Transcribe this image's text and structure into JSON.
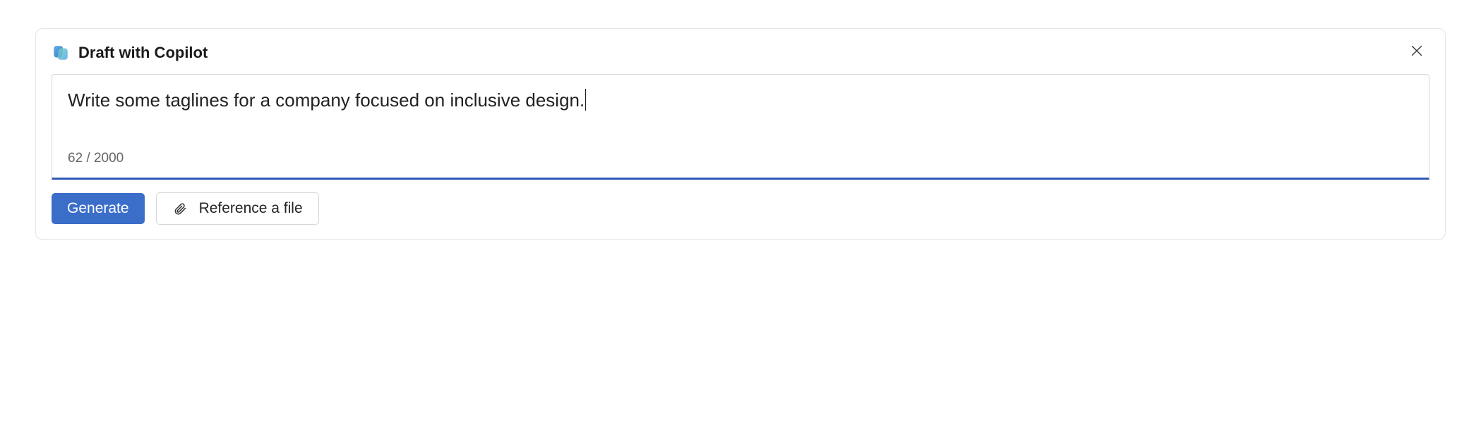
{
  "header": {
    "title": "Draft with Copilot"
  },
  "input": {
    "prompt_text": "Write some taglines for a company focused on inclusive design.",
    "char_count": "62 / 2000"
  },
  "buttons": {
    "generate_label": "Generate",
    "reference_label": "Reference a file"
  }
}
